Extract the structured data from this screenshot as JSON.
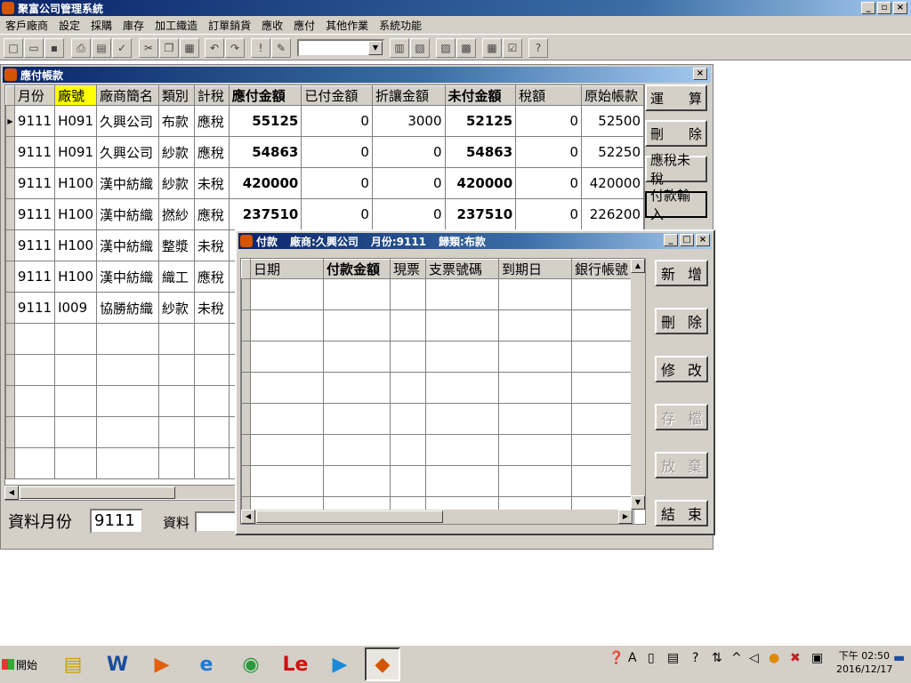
{
  "app": {
    "title": "聚富公司管理系統",
    "window_buttons": [
      "_",
      "▫",
      "×"
    ]
  },
  "menu": [
    "客戶廠商",
    "設定",
    "採購",
    "庫存",
    "加工織造",
    "訂單銷貨",
    "應收",
    "應付",
    "其他作業",
    "系統功能"
  ],
  "toolbar": {
    "icons": [
      "new-icon",
      "open-icon",
      "save-icon",
      "print-icon",
      "preview-icon",
      "spellcheck-icon",
      "cut-icon",
      "copy-icon",
      "paste-icon",
      "undo-icon",
      "redo-icon",
      "alert-icon",
      "edit-icon",
      "combo",
      "report-icon",
      "chart-icon",
      "tool-icon",
      "tool2-icon",
      "calc-icon",
      "check-icon",
      "help-icon"
    ],
    "combo_value": ""
  },
  "ap_window": {
    "title": "應付帳款",
    "columns": [
      "月份",
      "廠號",
      "廠商簡名",
      "類別",
      "計稅",
      "應付金額",
      "已付金額",
      "折讓金額",
      "未付金額",
      "稅額",
      "原始帳款"
    ],
    "rows": [
      [
        "9111",
        "H091",
        "久興公司",
        "布款",
        "應稅",
        "55125",
        "0",
        "3000",
        "52125",
        "0",
        "52500"
      ],
      [
        "9111",
        "H091",
        "久興公司",
        "紗款",
        "應稅",
        "54863",
        "0",
        "0",
        "54863",
        "0",
        "52250"
      ],
      [
        "9111",
        "H100",
        "漢中紡織",
        "紗款",
        "未稅",
        "420000",
        "0",
        "0",
        "420000",
        "0",
        "420000"
      ],
      [
        "9111",
        "H100",
        "漢中紡織",
        "撚紗",
        "應稅",
        "237510",
        "0",
        "0",
        "237510",
        "0",
        "226200"
      ],
      [
        "9111",
        "H100",
        "漢中紡織",
        "整漿",
        "未稅",
        "",
        "",
        "",
        "",
        "",
        ""
      ],
      [
        "9111",
        "H100",
        "漢中紡織",
        "織工",
        "應稅",
        "",
        "",
        "",
        "",
        "",
        ""
      ],
      [
        "9111",
        "I009",
        "協勝紡織",
        "紗款",
        "未稅",
        "",
        "",
        "",
        "",
        "",
        ""
      ]
    ],
    "side_buttons": {
      "calc": [
        "運",
        "算"
      ],
      "delete": [
        "刪",
        "除"
      ],
      "tax": "應稅未稅",
      "payment": "付款輸入"
    },
    "month_label": "資料月份",
    "month_value": "9111",
    "data_label": "資料"
  },
  "pay_window": {
    "title_parts": [
      "付款",
      "廠商:久興公司",
      "月份:9111",
      "歸類:布款"
    ],
    "columns": [
      "日期",
      "付款金額",
      "現票",
      "支票號碼",
      "到期日",
      "銀行帳號"
    ],
    "buttons": {
      "add": [
        "新",
        "增"
      ],
      "delete": [
        "刪",
        "除"
      ],
      "edit": [
        "修",
        "改"
      ],
      "save": [
        "存",
        "檔"
      ],
      "discard": [
        "放",
        "棄"
      ],
      "close": [
        "結",
        "束"
      ]
    }
  },
  "taskbar": {
    "start_label": "開始",
    "clock_time": "下午 02:50",
    "clock_date": "2016/12/17"
  }
}
